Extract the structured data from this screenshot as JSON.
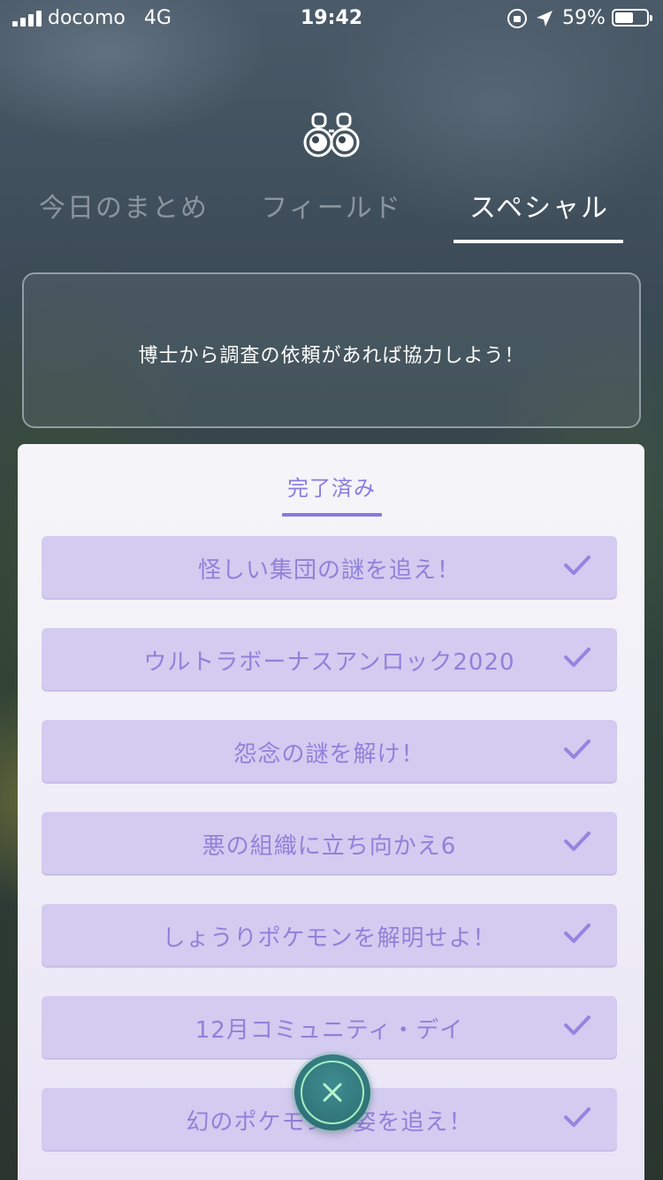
{
  "status_bar": {
    "carrier": "docomo",
    "network": "4G",
    "time": "19:42",
    "battery_percent": "59%",
    "battery_level": 0.59
  },
  "header": {
    "icon": "binoculars-icon",
    "tabs": [
      {
        "label": "今日のまとめ",
        "active": false
      },
      {
        "label": "フィールド",
        "active": false
      },
      {
        "label": "スペシャル",
        "active": true
      }
    ]
  },
  "info_box": {
    "text": "博士から調査の依頼があれば協力しよう！"
  },
  "panel": {
    "tab_label": "完了済み",
    "items": [
      {
        "label": "怪しい集団の謎を追え！",
        "status": "complete"
      },
      {
        "label": "ウルトラボーナスアンロック2020",
        "status": "complete"
      },
      {
        "label": "怨念の謎を解け！",
        "status": "complete"
      },
      {
        "label": "悪の組織に立ち向かえ6",
        "status": "complete"
      },
      {
        "label": "しょうりポケモンを解明せよ！",
        "status": "complete"
      },
      {
        "label": "12月コミュニティ・デイ",
        "status": "complete"
      },
      {
        "label": "幻のポケモンの姿を追え！",
        "status": "complete"
      }
    ]
  },
  "colors": {
    "accent": "#8a7ae0",
    "item_bg": "#d4cbf0",
    "close_button": "#2f7378"
  }
}
